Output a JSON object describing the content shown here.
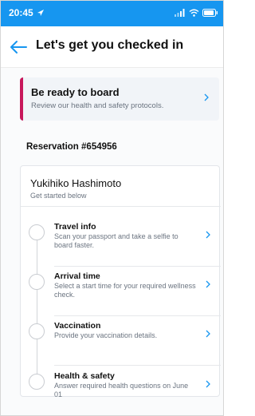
{
  "status_bar": {
    "time": "20:45"
  },
  "header": {
    "title": "Let's get you checked in"
  },
  "ready_card": {
    "title": "Be ready to board",
    "subtitle": "Review our health and safety protocols."
  },
  "reservation": {
    "label": "Reservation #654956"
  },
  "passenger": {
    "name": "Yukihiko Hashimoto",
    "subtitle": "Get started below"
  },
  "steps": [
    {
      "title": "Travel info",
      "description": "Scan your passport and take a selfie to board faster."
    },
    {
      "title": "Arrival time",
      "description": "Select a start time for your required wellness check."
    },
    {
      "title": "Vaccination",
      "description": "Provide your vaccination details."
    },
    {
      "title": "Health & safety",
      "description": "Answer required health questions on June 01"
    }
  ],
  "colors": {
    "status_bar": "#1696f0",
    "accent": "#1696f0",
    "ready_bar": "#c7175b"
  },
  "icons": {
    "back": "arrow-left-icon",
    "chevron": "chevron-right-icon",
    "location": "location-arrow-icon",
    "signal": "signal-icon",
    "wifi": "wifi-icon",
    "battery": "battery-icon"
  }
}
